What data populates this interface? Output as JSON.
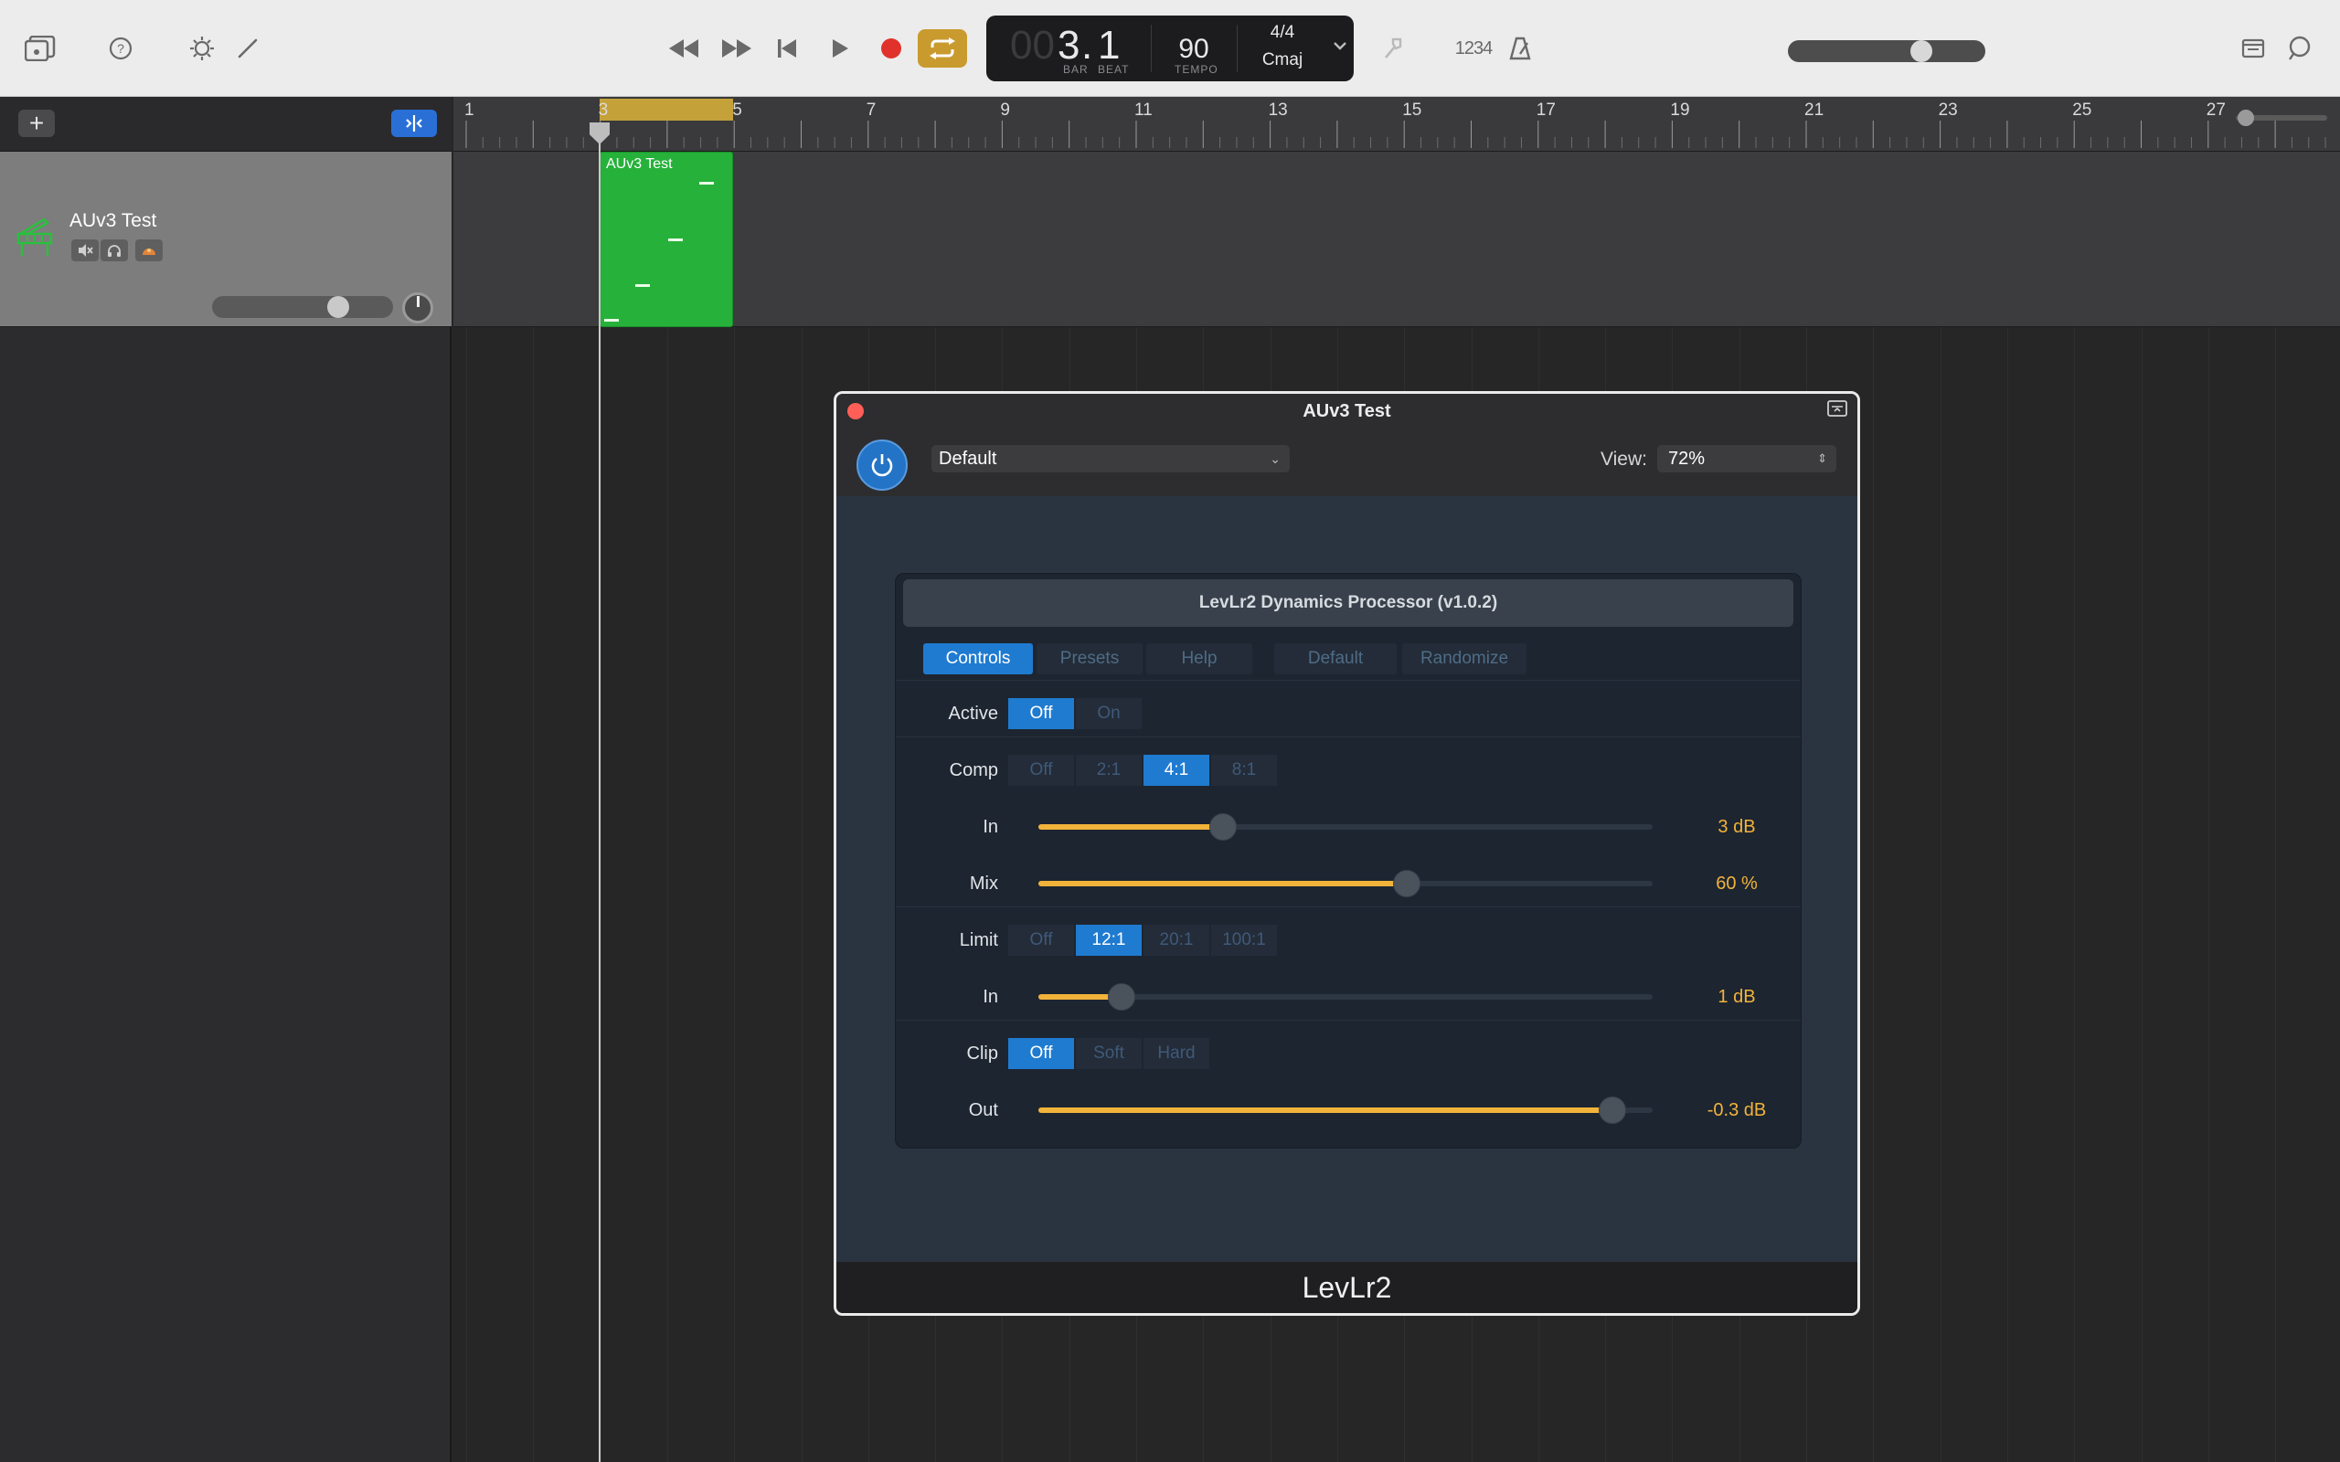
{
  "toolbar": {
    "lcd": {
      "bar_prefix": "00",
      "bar": "3",
      "beat": "1",
      "bar_caption": "BAR",
      "beat_caption": "BEAT",
      "tempo": "90",
      "tempo_caption": "TEMPO",
      "signature": "4/4",
      "key": "Cmaj"
    },
    "count_in_label": "1234",
    "icons": [
      "library-icon",
      "help-icon",
      "smart-controls-icon",
      "editors-icon",
      "rewind-icon",
      "fast-forward-icon",
      "go-to-beginning-icon",
      "play-icon",
      "record-icon",
      "cycle-icon",
      "tuner-icon",
      "metronome-icon",
      "notepad-icon",
      "loop-browser-icon"
    ],
    "accent_colors": {
      "cycle": "#c99a2e",
      "record": "#e0322b"
    }
  },
  "tracks": [
    {
      "name": "AUv3 Test",
      "icon": "piano-icon",
      "volume": 0.66,
      "instrument_color": "#27c23b"
    }
  ],
  "ruler": {
    "bars": [
      "1",
      "3",
      "5",
      "7",
      "9",
      "11",
      "13",
      "15",
      "17",
      "19",
      "21",
      "23",
      "25",
      "27"
    ],
    "cycle_start": 3,
    "cycle_end": 5
  },
  "region": {
    "name": "AUv3 Test",
    "color": "#26b13a"
  },
  "plugin_window": {
    "title": "AUv3 Test",
    "preset": "Default",
    "view_label": "View:",
    "view_value": "72%",
    "footer_name": "LevLr2",
    "panel": {
      "title": "LevLr2 Dynamics Processor (v1.0.2)",
      "tabs": [
        {
          "label": "Controls",
          "active": true
        },
        {
          "label": "Presets",
          "active": false
        },
        {
          "label": "Help",
          "active": false
        },
        {
          "label": "Default",
          "active": false
        },
        {
          "label": "Randomize",
          "active": false
        }
      ],
      "active": {
        "label": "Active",
        "options": [
          "Off",
          "On"
        ],
        "selected": "Off"
      },
      "comp": {
        "label": "Comp",
        "options": [
          "Off",
          "2:1",
          "4:1",
          "8:1"
        ],
        "selected": "4:1"
      },
      "comp_in": {
        "label": "In",
        "value": "3 dB",
        "level": 0.3
      },
      "mix": {
        "label": "Mix",
        "value": "60 %",
        "level": 0.6
      },
      "limit": {
        "label": "Limit",
        "options": [
          "Off",
          "12:1",
          "20:1",
          "100:1"
        ],
        "selected": "12:1"
      },
      "limit_in": {
        "label": "In",
        "value": "1 dB",
        "level": 0.135
      },
      "clip": {
        "label": "Clip",
        "options": [
          "Off",
          "Soft",
          "Hard"
        ],
        "selected": "Off"
      },
      "out": {
        "label": "Out",
        "value": "-0.3 dB",
        "level": 0.935
      },
      "colors": {
        "accent": "#1f7bd0",
        "value": "#f2b33a"
      }
    }
  }
}
